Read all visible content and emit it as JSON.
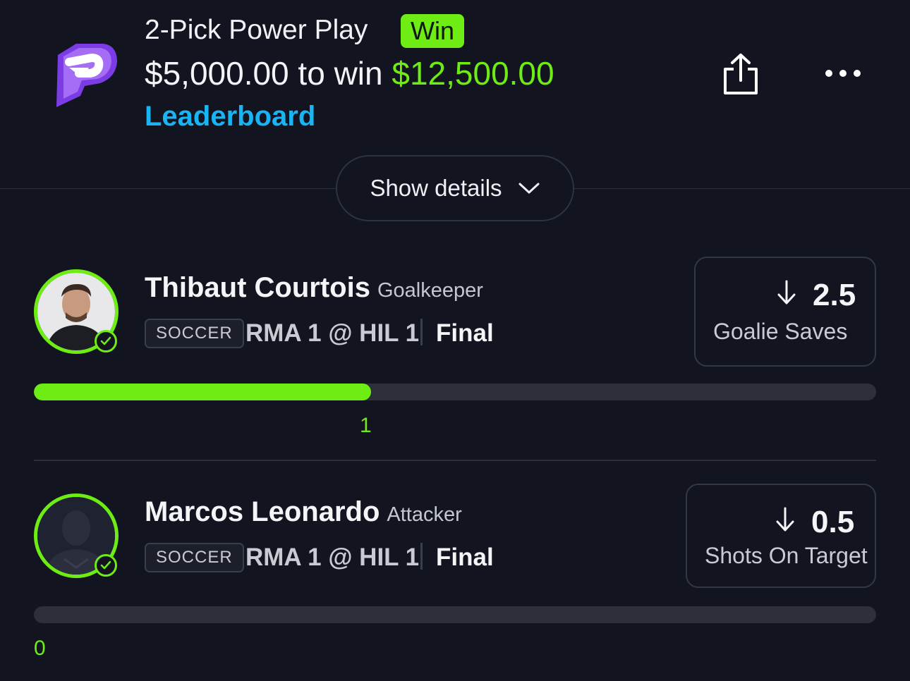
{
  "header": {
    "title": "2-Pick Power Play",
    "result_badge": "Win",
    "stake_prefix": "$5,000.00 to win ",
    "payout": "$12,500.00",
    "leaderboard_link": "Leaderboard",
    "brand_color": "#6eed15",
    "link_color": "#19b4f3",
    "logo_icon": "prizepicks-logo-icon",
    "share_icon": "share-icon",
    "more_icon": "more-horizontal-icon"
  },
  "details_toggle": {
    "label": "Show details"
  },
  "picks": [
    {
      "player": "Thibaut Courtois",
      "position": "Goalkeeper",
      "sport": "SOCCER",
      "matchup": "RMA 1 @ HIL 1",
      "status": "Final",
      "line": "2.5",
      "direction": "under",
      "stat": "Goalie Saves",
      "actual_label": "1",
      "progress_fraction": 0.4,
      "avatar_icon": "player-photo"
    },
    {
      "player": "Marcos Leonardo",
      "position": "Attacker",
      "sport": "SOCCER",
      "matchup": "RMA 1 @ HIL 1",
      "status": "Final",
      "line": "0.5",
      "direction": "under",
      "stat": "Shots On Target",
      "actual_label": "0",
      "progress_fraction": 0,
      "avatar_icon": "player-silhouette-icon"
    }
  ]
}
